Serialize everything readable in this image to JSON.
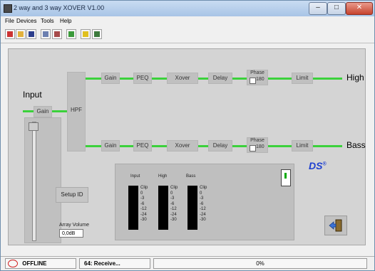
{
  "window": {
    "title": "2 way and 3 way XOVER  V1.00",
    "min": "–",
    "max": "□",
    "close": "✕"
  },
  "menu": [
    "File",
    "Devices",
    "Tools",
    "Help"
  ],
  "toolbar": [
    "wand-icon",
    "open-icon",
    "save-icon",
    "connect-icon",
    "disconnect-icon",
    "diamond-icon",
    "help-icon",
    "arrow-icon"
  ],
  "input_label": "Input",
  "input_gain": "Gain",
  "hpf": "HPF",
  "high": {
    "label": "High",
    "blocks": [
      "Gain",
      "PEQ",
      "Xover",
      "Delay"
    ],
    "phase": "Phase",
    "phase_val": "180",
    "limit": "Limit"
  },
  "bass": {
    "label": "Bass",
    "blocks": [
      "Gain",
      "PEQ",
      "Xover",
      "Delay"
    ],
    "phase": "Phase",
    "phase_val": "180",
    "limit": "Limit"
  },
  "setup_id": "Setup ID",
  "array_volume": {
    "label": "Array Volume",
    "value": "0,0dB"
  },
  "meters": {
    "headers": [
      "Input",
      "High",
      "Bass"
    ],
    "levels": [
      "Clip",
      "0",
      "-3",
      "-6",
      "-12",
      "-24",
      "-30"
    ]
  },
  "logo": {
    "text": "DS",
    "reg": "®"
  },
  "status": {
    "offline": "OFFLINE",
    "message": "64: Receive...",
    "progress": "0%"
  },
  "colors": {
    "signal": "#3bd13b"
  }
}
